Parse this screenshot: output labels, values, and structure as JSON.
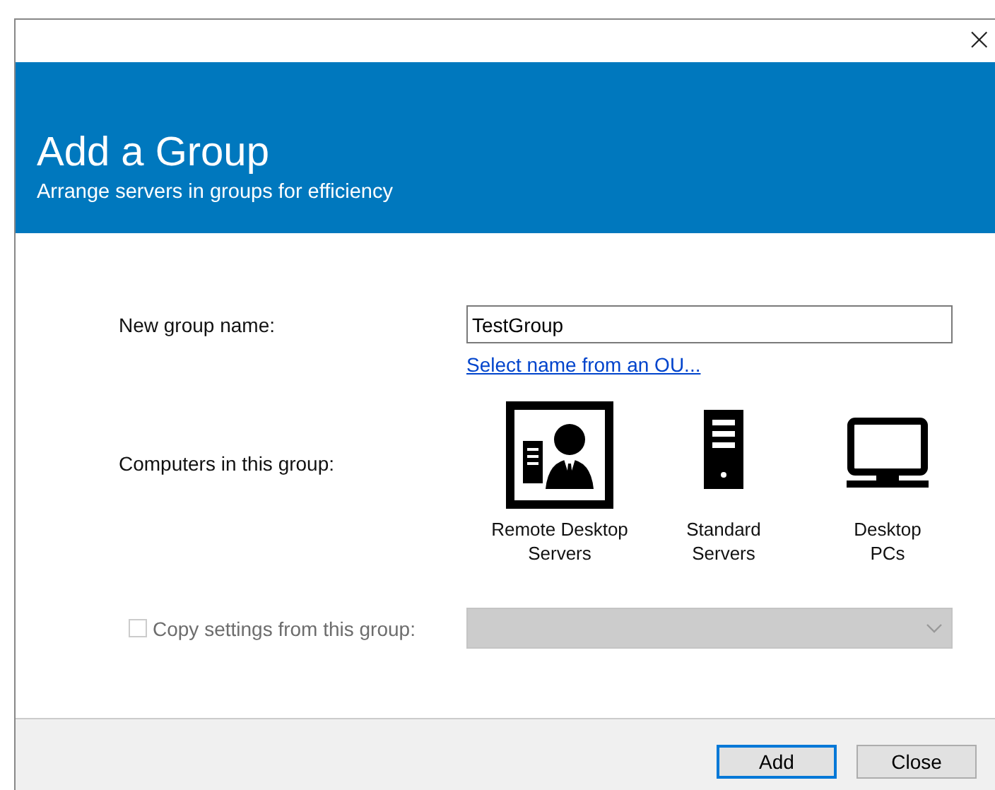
{
  "window": {
    "close": "×"
  },
  "header": {
    "title": "Add a Group",
    "subtitle": "Arrange servers in groups for efficiency"
  },
  "name_field": {
    "label": "New group name:",
    "value": "TestGroup"
  },
  "ou_link": "Select name from an OU...",
  "group_types": {
    "label": "Computers in this group:",
    "items": [
      {
        "kind": "remote",
        "label": "Remote Desktop\nServers",
        "selected": true
      },
      {
        "kind": "server",
        "label": "Standard\nServers",
        "selected": false
      },
      {
        "kind": "desktop",
        "label": "Desktop\nPCs",
        "selected": false
      }
    ]
  },
  "copy_settings": {
    "label": "Copy settings from this group:",
    "checked": false,
    "disabled": true
  },
  "buttons": [
    {
      "label": "Add",
      "focused": true
    },
    {
      "label": "Close",
      "focused": false
    }
  ]
}
